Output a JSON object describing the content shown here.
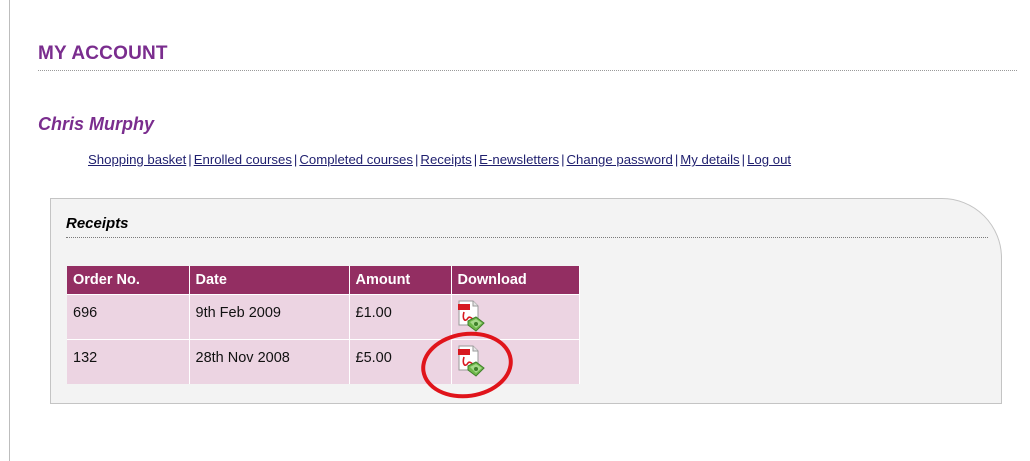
{
  "page": {
    "title": "MY ACCOUNT",
    "user_name": "Chris Murphy"
  },
  "nav": {
    "items": [
      {
        "label": "Shopping basket"
      },
      {
        "label": "Enrolled courses"
      },
      {
        "label": "Completed courses"
      },
      {
        "label": "Receipts"
      },
      {
        "label": "E-newsletters"
      },
      {
        "label": "Change password"
      },
      {
        "label": "My details"
      },
      {
        "label": "Log out"
      }
    ],
    "separator": "|"
  },
  "receipts": {
    "title": "Receipts",
    "columns": [
      "Order No.",
      "Date",
      "Amount",
      "Download"
    ],
    "rows": [
      {
        "order_no": "696",
        "date": "9th Feb 2009",
        "amount": "£1.00",
        "download_icon": "pdf-download-icon"
      },
      {
        "order_no": "132",
        "date": "28th Nov 2008",
        "amount": "£5.00",
        "download_icon": "pdf-download-icon"
      }
    ]
  },
  "annotation": {
    "highlight_color": "#e0141b",
    "highlights_row": 1
  },
  "colors": {
    "title_purple": "#7a2d8e",
    "table_header": "#932e62",
    "table_row": "#ecd4e2",
    "link": "#1f1f6e"
  }
}
